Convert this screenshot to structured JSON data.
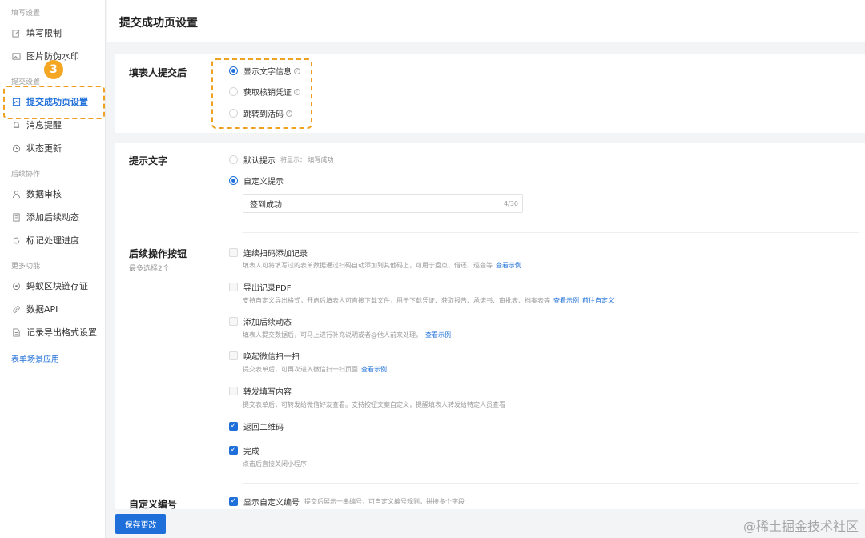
{
  "sidebar": {
    "group_fill": "填写设置",
    "item_limit": "填写限制",
    "item_watermark": "图片防伪水印",
    "group_submit": "提交设置",
    "item_success_page": "提交成功页设置",
    "item_message": "消息提醒",
    "item_status": "状态更新",
    "group_followup": "后续协作",
    "item_review": "数据审核",
    "item_followup_dynamic": "添加后续动态",
    "item_progress": "标记处理进度",
    "group_more": "更多功能",
    "item_blockchain": "蚂蚁区块链存证",
    "item_api": "数据API",
    "item_export_format": "记录导出格式设置",
    "link_scenarios": "表单场景应用",
    "step_badge": "3"
  },
  "header": {
    "title": "提交成功页设置"
  },
  "after_submit": {
    "label": "填表人提交后",
    "options": [
      "显示文字信息",
      "获取核销凭证",
      "跳转到活码"
    ]
  },
  "tip_text": {
    "label": "提示文字",
    "default_label": "默认提示",
    "default_hint": "将显示： 填写成功",
    "custom_label": "自定义提示",
    "input_value": "签到成功",
    "counter": "4/30"
  },
  "followup_buttons": {
    "label": "后续操作按钮",
    "sub": "最多选择2个",
    "items": [
      {
        "label": "连续扫码添加记录",
        "desc": "填表人可将填写过的表单数据通过扫码自动添加到其他码上，可用于盘点、借还、巡查等",
        "link": "查看示例"
      },
      {
        "label": "导出记录PDF",
        "desc": "支持自定义导出格式，开启后填表人可直接下载文件，用于下载凭证、获取报告、承诺书、审批表、档案表等",
        "link": "查看示例",
        "link2": "前往自定义"
      },
      {
        "label": "添加后续动态",
        "desc": "填表人提交数据后，可马上进行补充说明或者@他人前来处理，",
        "link": "查看示例"
      },
      {
        "label": "唤起微信扫一扫",
        "desc": "提交表单后，可再次进入微信扫一扫页面",
        "link": "查看示例"
      },
      {
        "label": "转发填写内容",
        "desc": "提交表单后，可转发给微信好友查看。支持按钮文案自定义，提醒填表人转发给特定人员查看"
      },
      {
        "label": "返回二维码"
      },
      {
        "label": "完成",
        "desc": "点击后直接关闭小程序"
      }
    ]
  },
  "custom_number": {
    "label": "自定义编号",
    "option": "显示自定义编号",
    "hint": "提交后展示一串编号，可自定义编号规则，拼接多个字段"
  },
  "save_button": "保存更改",
  "watermark": "@稀土掘金技术社区",
  "colors": {
    "accent": "#1e6fd9",
    "highlight": "#f0a020",
    "badge": "#f5a623"
  }
}
